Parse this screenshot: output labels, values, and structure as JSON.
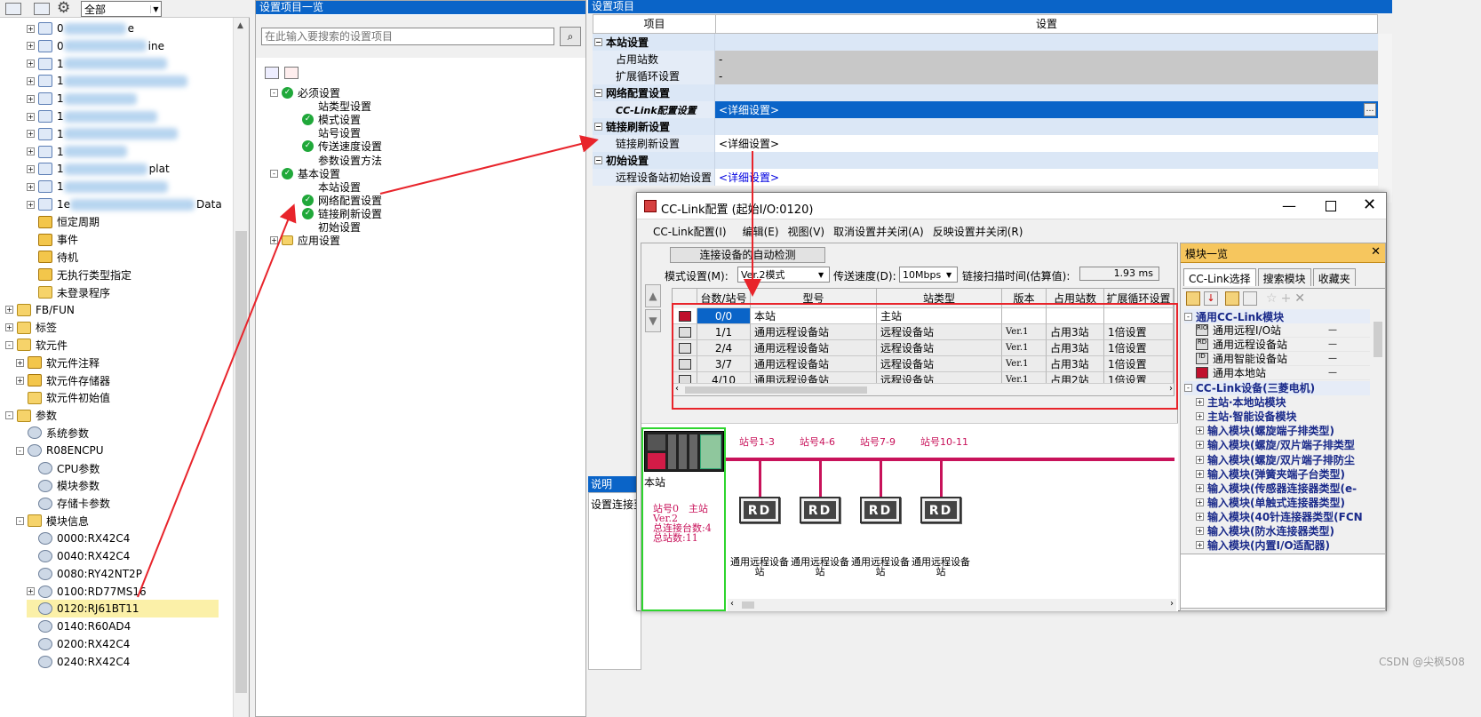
{
  "toolbar": {
    "filter_value": "全部"
  },
  "project_tree": {
    "blurred_items": [
      {
        "prefix": "0",
        "suffix": "e"
      },
      {
        "prefix": "0",
        "suffix": "ine"
      },
      {
        "prefix": "1",
        "suffix": ""
      },
      {
        "prefix": "1",
        "suffix": ""
      },
      {
        "prefix": "1",
        "suffix": ""
      },
      {
        "prefix": "1",
        "suffix": ""
      },
      {
        "prefix": "1",
        "suffix": ""
      },
      {
        "prefix": "1",
        "suffix": ""
      },
      {
        "prefix": "1",
        "suffix": "plat"
      },
      {
        "prefix": "1",
        "suffix": ""
      },
      {
        "prefix": "1e",
        "suffix": "Data"
      }
    ],
    "items": [
      {
        "label": "恒定周期",
        "level": 2,
        "icon": "doc",
        "expander": ""
      },
      {
        "label": "事件",
        "level": 2,
        "icon": "doc",
        "expander": ""
      },
      {
        "label": "待机",
        "level": 2,
        "icon": "doc",
        "expander": ""
      },
      {
        "label": "无执行类型指定",
        "level": 2,
        "icon": "doc",
        "expander": ""
      },
      {
        "label": "未登录程序",
        "level": 2,
        "icon": "folder",
        "expander": ""
      },
      {
        "label": "FB/FUN",
        "level": 0,
        "icon": "folder",
        "expander": "+"
      },
      {
        "label": "标签",
        "level": 0,
        "icon": "folder",
        "expander": "+"
      },
      {
        "label": "软元件",
        "level": 0,
        "icon": "folder",
        "expander": "-"
      },
      {
        "label": "软元件注释",
        "level": 1,
        "icon": "doc",
        "expander": "+"
      },
      {
        "label": "软元件存储器",
        "level": 1,
        "icon": "doc",
        "expander": "+"
      },
      {
        "label": "软元件初始值",
        "level": 1,
        "icon": "folder",
        "expander": ""
      },
      {
        "label": "参数",
        "level": 0,
        "icon": "folder",
        "expander": "-"
      },
      {
        "label": "系统参数",
        "level": 1,
        "icon": "gear",
        "expander": ""
      },
      {
        "label": "R08ENCPU",
        "level": 1,
        "icon": "gear",
        "expander": "-"
      },
      {
        "label": "CPU参数",
        "level": 2,
        "icon": "gear",
        "expander": ""
      },
      {
        "label": "模块参数",
        "level": 2,
        "icon": "gear",
        "expander": ""
      },
      {
        "label": "存储卡参数",
        "level": 2,
        "icon": "gear",
        "expander": ""
      },
      {
        "label": "模块信息",
        "level": 1,
        "icon": "folder",
        "expander": "-"
      },
      {
        "label": "0000:RX42C4",
        "level": 2,
        "icon": "gear",
        "expander": ""
      },
      {
        "label": "0040:RX42C4",
        "level": 2,
        "icon": "gear",
        "expander": ""
      },
      {
        "label": "0080:RY42NT2P",
        "level": 2,
        "icon": "gear",
        "expander": ""
      },
      {
        "label": "0100:RD77MS16",
        "level": 2,
        "icon": "gear",
        "expander": "+"
      },
      {
        "label": "0120:RJ61BT11",
        "level": 2,
        "icon": "gear",
        "expander": "",
        "selected": true
      },
      {
        "label": "0140:R60AD4",
        "level": 2,
        "icon": "gear",
        "expander": ""
      },
      {
        "label": "0200:RX42C4",
        "level": 2,
        "icon": "gear",
        "expander": ""
      },
      {
        "label": "0240:RX42C4",
        "level": 2,
        "icon": "gear",
        "expander": ""
      }
    ]
  },
  "setting_list": {
    "title": "设置项目一览",
    "search_placeholder": "在此输入要搜索的设置项目",
    "tree": [
      {
        "label": "必须设置",
        "level": 0,
        "check": true,
        "expander": "-"
      },
      {
        "label": "站类型设置",
        "level": 1,
        "check": false
      },
      {
        "label": "模式设置",
        "level": 1,
        "check": true
      },
      {
        "label": "站号设置",
        "level": 1,
        "check": false
      },
      {
        "label": "传送速度设置",
        "level": 1,
        "check": true
      },
      {
        "label": "参数设置方法",
        "level": 1,
        "check": false
      },
      {
        "label": "基本设置",
        "level": 0,
        "check": true,
        "expander": "-"
      },
      {
        "label": "本站设置",
        "level": 1,
        "check": false
      },
      {
        "label": "网络配置设置",
        "level": 1,
        "check": true
      },
      {
        "label": "链接刷新设置",
        "level": 1,
        "check": true
      },
      {
        "label": "初始设置",
        "level": 1,
        "check": false
      },
      {
        "label": "应用设置",
        "level": 0,
        "check": false,
        "expander": "+"
      }
    ]
  },
  "setting_items": {
    "title": "设置项目",
    "col_item": "项目",
    "col_setting": "设置",
    "rows": [
      {
        "item": "本站设置",
        "setting": "",
        "group": true
      },
      {
        "item": "占用站数",
        "setting": "-",
        "group": false,
        "gray": true
      },
      {
        "item": "扩展循环设置",
        "setting": "-",
        "group": false,
        "gray": true
      },
      {
        "item": "网络配置设置",
        "setting": "",
        "group": true
      },
      {
        "item": "CC-Link配置设置",
        "setting": "<详细设置>",
        "group": false,
        "selected": true
      },
      {
        "item": "链接刷新设置",
        "setting": "",
        "group": true
      },
      {
        "item": "链接刷新设置",
        "setting": "<详细设置>",
        "group": false
      },
      {
        "item": "初始设置",
        "setting": "",
        "group": true
      },
      {
        "item": "远程设备站初始设置",
        "setting": "<详细设置>",
        "group": false,
        "link": true
      }
    ],
    "explain_title": "说明",
    "explain_text": "设置连接至"
  },
  "dialog": {
    "title": "CC-Link配置 (起始I/O:0120)",
    "menu": [
      "CC-Link配置(I)",
      "编辑(E)",
      "视图(V)",
      "取消设置并关闭(A)",
      "反映设置并关闭(R)"
    ],
    "auto_detect_button": "连接设备的自动检测",
    "mode_label": "模式设置(M):",
    "mode_value": "Ver.2模式",
    "speed_label": "传送速度(D):",
    "speed_value": "10Mbps",
    "scan_label": "链接扫描时间(估算值):",
    "scan_value": "1.93 ms",
    "grid_headers": [
      "台数/站号",
      "型号",
      "站类型",
      "版本",
      "占用站数",
      "扩展循环设置"
    ],
    "grid_rows": [
      {
        "no": "0/0",
        "model": "本站",
        "type": "主站",
        "ver": "",
        "occ": "",
        "ext": "",
        "selected": true
      },
      {
        "no": "1/1",
        "model": "通用远程设备站",
        "type": "远程设备站",
        "ver": "Ver.1",
        "occ": "占用3站",
        "ext": "1倍设置"
      },
      {
        "no": "2/4",
        "model": "通用远程设备站",
        "type": "远程设备站",
        "ver": "Ver.1",
        "occ": "占用3站",
        "ext": "1倍设置"
      },
      {
        "no": "3/7",
        "model": "通用远程设备站",
        "type": "远程设备站",
        "ver": "Ver.1",
        "occ": "占用3站",
        "ext": "1倍设置"
      },
      {
        "no": "4/10",
        "model": "通用远程设备站",
        "type": "远程设备站",
        "ver": "Ver.1",
        "occ": "占用2站",
        "ext": "1倍设置"
      }
    ],
    "master_label": "本站",
    "master_info": [
      "站号0　主站",
      "Ver.2",
      "总连接台数:4",
      "总站数:11"
    ],
    "stations": [
      {
        "range": "站号1-3",
        "badge": "RD",
        "name": "通用远程设备站"
      },
      {
        "range": "站号4-6",
        "badge": "RD",
        "name": "通用远程设备站"
      },
      {
        "range": "站号7-9",
        "badge": "RD",
        "name": "通用远程设备站"
      },
      {
        "range": "站号10-11",
        "badge": "RD",
        "name": "通用远程设备站"
      }
    ]
  },
  "module_list": {
    "title": "模块一览",
    "tabs": [
      "CC-Link选择",
      "搜索模块",
      "收藏夹"
    ],
    "items": [
      {
        "label": "通用CC-Link模块",
        "level": 0,
        "bold": true,
        "expander": "-"
      },
      {
        "label": "通用远程I/O站",
        "level": 1,
        "badge": "RIO",
        "dash": "—"
      },
      {
        "label": "通用远程设备站",
        "level": 1,
        "badge": "RD",
        "dash": "—"
      },
      {
        "label": "通用智能设备站",
        "level": 1,
        "badge": "ID",
        "dash": "—"
      },
      {
        "label": "通用本地站",
        "level": 1,
        "badge": "LS",
        "dash": "—"
      },
      {
        "label": "CC-Link设备(三菱电机)",
        "level": 0,
        "bold": true,
        "expander": "-"
      },
      {
        "label": "主站·本地站模块",
        "level": 1,
        "expander": "+"
      },
      {
        "label": "主站·智能设备模块",
        "level": 1,
        "expander": "+"
      },
      {
        "label": "输入模块(螺旋端子排类型)",
        "level": 1,
        "expander": "+"
      },
      {
        "label": "输入模块(螺旋/双片端子排类型",
        "level": 1,
        "expander": "+"
      },
      {
        "label": "输入模块(螺旋/双片端子排防尘",
        "level": 1,
        "expander": "+"
      },
      {
        "label": "输入模块(弹簧夹端子台类型)",
        "level": 1,
        "expander": "+"
      },
      {
        "label": "输入模块(传感器连接器类型(e-",
        "level": 1,
        "expander": "+"
      },
      {
        "label": "输入模块(单触式连接器类型)",
        "level": 1,
        "expander": "+"
      },
      {
        "label": "输入模块(40针连接器类型(FCN",
        "level": 1,
        "expander": "+"
      },
      {
        "label": "输入模块(防水连接器类型)",
        "level": 1,
        "expander": "+"
      },
      {
        "label": "输入模块(内置I/O适配器)",
        "level": 1,
        "expander": "+"
      }
    ]
  },
  "watermark": "CSDN @尖枫508",
  "colors": {
    "selection": "#0a64c8",
    "highlight_red": "#e8242b",
    "highlight_green": "#2ed52e",
    "net_line": "#c8125a"
  }
}
